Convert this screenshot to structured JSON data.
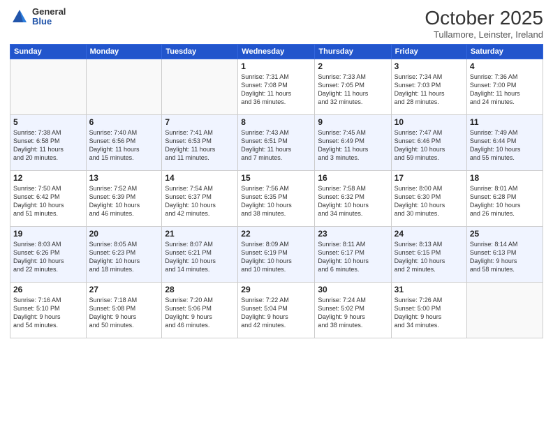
{
  "logo": {
    "general": "General",
    "blue": "Blue"
  },
  "header": {
    "month": "October 2025",
    "location": "Tullamore, Leinster, Ireland"
  },
  "days_of_week": [
    "Sunday",
    "Monday",
    "Tuesday",
    "Wednesday",
    "Thursday",
    "Friday",
    "Saturday"
  ],
  "weeks": [
    [
      {
        "day": "",
        "info": ""
      },
      {
        "day": "",
        "info": ""
      },
      {
        "day": "",
        "info": ""
      },
      {
        "day": "1",
        "info": "Sunrise: 7:31 AM\nSunset: 7:08 PM\nDaylight: 11 hours\nand 36 minutes."
      },
      {
        "day": "2",
        "info": "Sunrise: 7:33 AM\nSunset: 7:05 PM\nDaylight: 11 hours\nand 32 minutes."
      },
      {
        "day": "3",
        "info": "Sunrise: 7:34 AM\nSunset: 7:03 PM\nDaylight: 11 hours\nand 28 minutes."
      },
      {
        "day": "4",
        "info": "Sunrise: 7:36 AM\nSunset: 7:00 PM\nDaylight: 11 hours\nand 24 minutes."
      }
    ],
    [
      {
        "day": "5",
        "info": "Sunrise: 7:38 AM\nSunset: 6:58 PM\nDaylight: 11 hours\nand 20 minutes."
      },
      {
        "day": "6",
        "info": "Sunrise: 7:40 AM\nSunset: 6:56 PM\nDaylight: 11 hours\nand 15 minutes."
      },
      {
        "day": "7",
        "info": "Sunrise: 7:41 AM\nSunset: 6:53 PM\nDaylight: 11 hours\nand 11 minutes."
      },
      {
        "day": "8",
        "info": "Sunrise: 7:43 AM\nSunset: 6:51 PM\nDaylight: 11 hours\nand 7 minutes."
      },
      {
        "day": "9",
        "info": "Sunrise: 7:45 AM\nSunset: 6:49 PM\nDaylight: 11 hours\nand 3 minutes."
      },
      {
        "day": "10",
        "info": "Sunrise: 7:47 AM\nSunset: 6:46 PM\nDaylight: 10 hours\nand 59 minutes."
      },
      {
        "day": "11",
        "info": "Sunrise: 7:49 AM\nSunset: 6:44 PM\nDaylight: 10 hours\nand 55 minutes."
      }
    ],
    [
      {
        "day": "12",
        "info": "Sunrise: 7:50 AM\nSunset: 6:42 PM\nDaylight: 10 hours\nand 51 minutes."
      },
      {
        "day": "13",
        "info": "Sunrise: 7:52 AM\nSunset: 6:39 PM\nDaylight: 10 hours\nand 46 minutes."
      },
      {
        "day": "14",
        "info": "Sunrise: 7:54 AM\nSunset: 6:37 PM\nDaylight: 10 hours\nand 42 minutes."
      },
      {
        "day": "15",
        "info": "Sunrise: 7:56 AM\nSunset: 6:35 PM\nDaylight: 10 hours\nand 38 minutes."
      },
      {
        "day": "16",
        "info": "Sunrise: 7:58 AM\nSunset: 6:32 PM\nDaylight: 10 hours\nand 34 minutes."
      },
      {
        "day": "17",
        "info": "Sunrise: 8:00 AM\nSunset: 6:30 PM\nDaylight: 10 hours\nand 30 minutes."
      },
      {
        "day": "18",
        "info": "Sunrise: 8:01 AM\nSunset: 6:28 PM\nDaylight: 10 hours\nand 26 minutes."
      }
    ],
    [
      {
        "day": "19",
        "info": "Sunrise: 8:03 AM\nSunset: 6:26 PM\nDaylight: 10 hours\nand 22 minutes."
      },
      {
        "day": "20",
        "info": "Sunrise: 8:05 AM\nSunset: 6:23 PM\nDaylight: 10 hours\nand 18 minutes."
      },
      {
        "day": "21",
        "info": "Sunrise: 8:07 AM\nSunset: 6:21 PM\nDaylight: 10 hours\nand 14 minutes."
      },
      {
        "day": "22",
        "info": "Sunrise: 8:09 AM\nSunset: 6:19 PM\nDaylight: 10 hours\nand 10 minutes."
      },
      {
        "day": "23",
        "info": "Sunrise: 8:11 AM\nSunset: 6:17 PM\nDaylight: 10 hours\nand 6 minutes."
      },
      {
        "day": "24",
        "info": "Sunrise: 8:13 AM\nSunset: 6:15 PM\nDaylight: 10 hours\nand 2 minutes."
      },
      {
        "day": "25",
        "info": "Sunrise: 8:14 AM\nSunset: 6:13 PM\nDaylight: 9 hours\nand 58 minutes."
      }
    ],
    [
      {
        "day": "26",
        "info": "Sunrise: 7:16 AM\nSunset: 5:10 PM\nDaylight: 9 hours\nand 54 minutes."
      },
      {
        "day": "27",
        "info": "Sunrise: 7:18 AM\nSunset: 5:08 PM\nDaylight: 9 hours\nand 50 minutes."
      },
      {
        "day": "28",
        "info": "Sunrise: 7:20 AM\nSunset: 5:06 PM\nDaylight: 9 hours\nand 46 minutes."
      },
      {
        "day": "29",
        "info": "Sunrise: 7:22 AM\nSunset: 5:04 PM\nDaylight: 9 hours\nand 42 minutes."
      },
      {
        "day": "30",
        "info": "Sunrise: 7:24 AM\nSunset: 5:02 PM\nDaylight: 9 hours\nand 38 minutes."
      },
      {
        "day": "31",
        "info": "Sunrise: 7:26 AM\nSunset: 5:00 PM\nDaylight: 9 hours\nand 34 minutes."
      },
      {
        "day": "",
        "info": ""
      }
    ]
  ]
}
